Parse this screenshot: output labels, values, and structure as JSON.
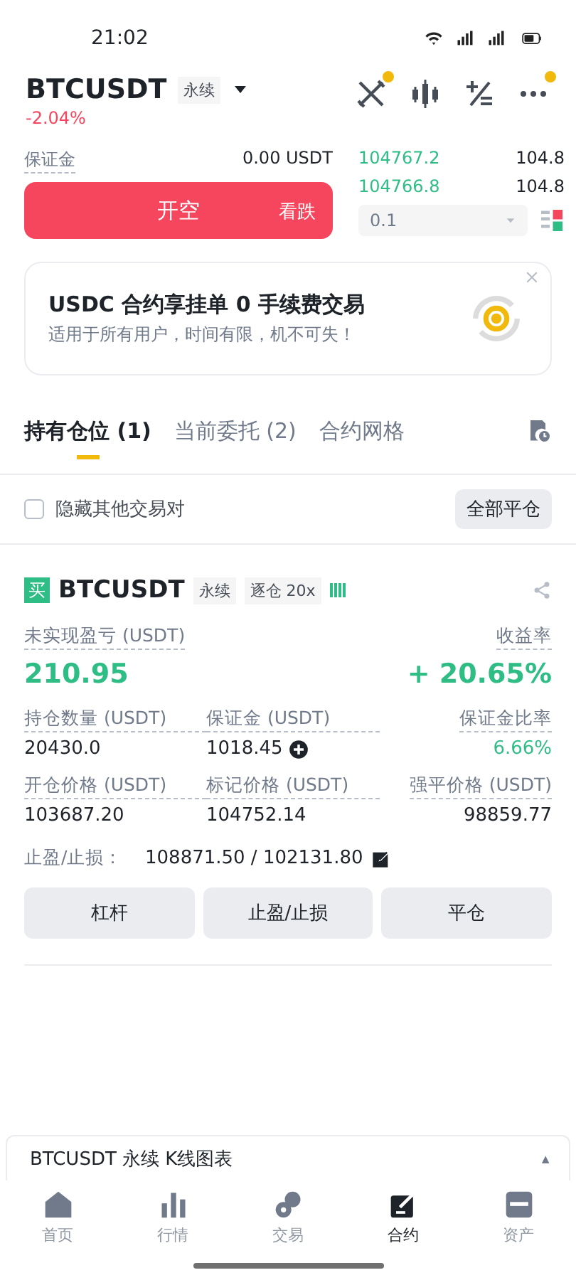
{
  "status_bar": {
    "time": "21:02"
  },
  "header": {
    "symbol": "BTCUSDT",
    "tag": "永续",
    "change": "-2.04%",
    "actions": [
      {
        "kind": "swords",
        "dot": true
      },
      {
        "kind": "candles",
        "dot": false
      },
      {
        "kind": "plusminus",
        "dot": false
      },
      {
        "kind": "more",
        "dot": true
      }
    ]
  },
  "order": {
    "margin_label": "保证金",
    "margin_value": "0.00 USDT",
    "button_label": "开空",
    "button_hint": "看跌",
    "book": [
      {
        "price": "104767.2",
        "amount": "104.8"
      },
      {
        "price": "104766.8",
        "amount": "104.8"
      }
    ],
    "step": "0.1"
  },
  "promo": {
    "title": "USDC 合约享挂单 0 手续费交易",
    "subtitle": "适用于所有用户，时间有限，机不可失！"
  },
  "tabs": [
    {
      "label": "持有仓位 (1)",
      "selected": true
    },
    {
      "label": "当前委托 (2)",
      "selected": false
    },
    {
      "label": "合约网格",
      "selected": false
    }
  ],
  "filter": {
    "label": "隐藏其他交易对",
    "checked": false,
    "close_all": "全部平仓"
  },
  "position": {
    "side": "买",
    "symbol": "BTCUSDT",
    "tags": [
      "永续",
      "逐仓 20x"
    ],
    "pnl_label": "未实现盈亏 (USDT)",
    "pnl": "210.95",
    "roi_label": "收益率",
    "roi": "+ 20.65%",
    "stats": [
      {
        "label": "持仓数量 (USDT)",
        "value": "20430.0",
        "kind": "plain"
      },
      {
        "label": "保证金 (USDT)",
        "value": "1018.45",
        "kind": "add"
      },
      {
        "label": "保证金比率",
        "value": "6.66%",
        "kind": "ratio"
      },
      {
        "label": "开仓价格 (USDT)",
        "value": "103687.20",
        "kind": "plain"
      },
      {
        "label": "标记价格 (USDT)",
        "value": "104752.14",
        "kind": "plain"
      },
      {
        "label": "强平价格 (USDT)",
        "value": "98859.77",
        "kind": "plain"
      }
    ],
    "tpsl_label": "止盈/止损：",
    "tpsl_value": "108871.50 / 102131.80",
    "buttons": [
      "杠杆",
      "止盈/止损",
      "平仓"
    ]
  },
  "chart_bar": {
    "title": "BTCUSDT 永续 K线图表",
    "arrow": "▲"
  },
  "nav": [
    {
      "label": "首页",
      "kind": "home",
      "selected": false
    },
    {
      "label": "行情",
      "kind": "bars",
      "selected": false
    },
    {
      "label": "交易",
      "kind": "trade",
      "selected": false
    },
    {
      "label": "合约",
      "kind": "futures",
      "selected": true
    },
    {
      "label": "资产",
      "kind": "wallet",
      "selected": false
    }
  ]
}
